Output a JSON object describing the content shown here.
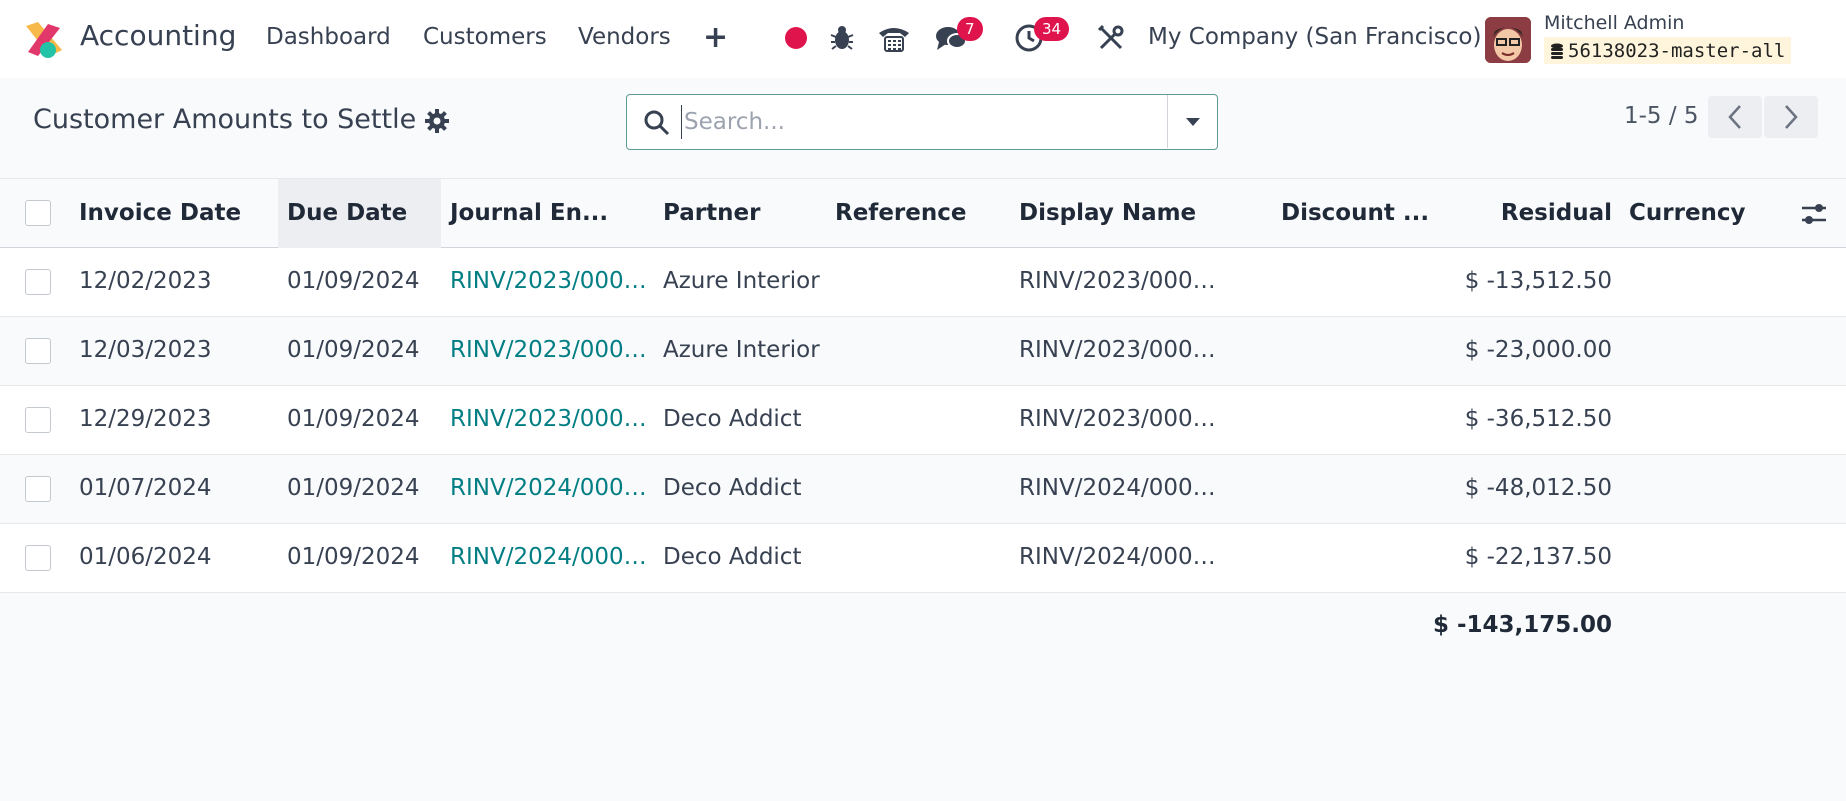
{
  "navbar": {
    "app_name": "Accounting",
    "menu": [
      "Dashboard",
      "Customers",
      "Vendors"
    ],
    "chat_count": "7",
    "activity_count": "34",
    "company": "My Company (San Francisco)",
    "user_name": "Mitchell Admin",
    "database": "56138023-master-all",
    "colors": {
      "badge": "#e0144c",
      "record": "#e0144c"
    }
  },
  "control_panel": {
    "title": "Customer Amounts to Settle",
    "search_placeholder": "Search...",
    "pager": "1-5 / 5"
  },
  "table": {
    "columns": [
      "Invoice Date",
      "Due Date",
      "Journal En...",
      "Partner",
      "Reference",
      "Display Name",
      "Discount ...",
      "Residual",
      "Currency"
    ],
    "rows": [
      {
        "invoice_date": "12/02/2023",
        "due_date": "01/09/2024",
        "journal_entry": "RINV/2023/000…",
        "partner": "Azure Interior",
        "reference": "",
        "display_name": "RINV/2023/000…",
        "discount": "",
        "residual": "$ -13,512.50",
        "currency": ""
      },
      {
        "invoice_date": "12/03/2023",
        "due_date": "01/09/2024",
        "journal_entry": "RINV/2023/000…",
        "partner": "Azure Interior",
        "reference": "",
        "display_name": "RINV/2023/000…",
        "discount": "",
        "residual": "$ -23,000.00",
        "currency": ""
      },
      {
        "invoice_date": "12/29/2023",
        "due_date": "01/09/2024",
        "journal_entry": "RINV/2023/000…",
        "partner": "Deco Addict",
        "reference": "",
        "display_name": "RINV/2023/000…",
        "discount": "",
        "residual": "$ -36,512.50",
        "currency": ""
      },
      {
        "invoice_date": "01/07/2024",
        "due_date": "01/09/2024",
        "journal_entry": "RINV/2024/000…",
        "partner": "Deco Addict",
        "reference": "",
        "display_name": "RINV/2024/000…",
        "discount": "",
        "residual": "$ -48,012.50",
        "currency": ""
      },
      {
        "invoice_date": "01/06/2024",
        "due_date": "01/09/2024",
        "journal_entry": "RINV/2024/000…",
        "partner": "Deco Addict",
        "reference": "",
        "display_name": "RINV/2024/000…",
        "discount": "",
        "residual": "$ -22,137.50",
        "currency": ""
      }
    ],
    "total_residual": "$ -143,175.00",
    "link_color": "#017e84"
  },
  "icons": [
    "app-logo-icon",
    "record-icon",
    "bug-icon",
    "phone-icon",
    "chat-icon",
    "clock-icon",
    "tools-icon",
    "database-icon",
    "gear-icon",
    "search-icon",
    "caret-down-icon",
    "chevron-left-icon",
    "chevron-right-icon",
    "column-settings-icon"
  ]
}
